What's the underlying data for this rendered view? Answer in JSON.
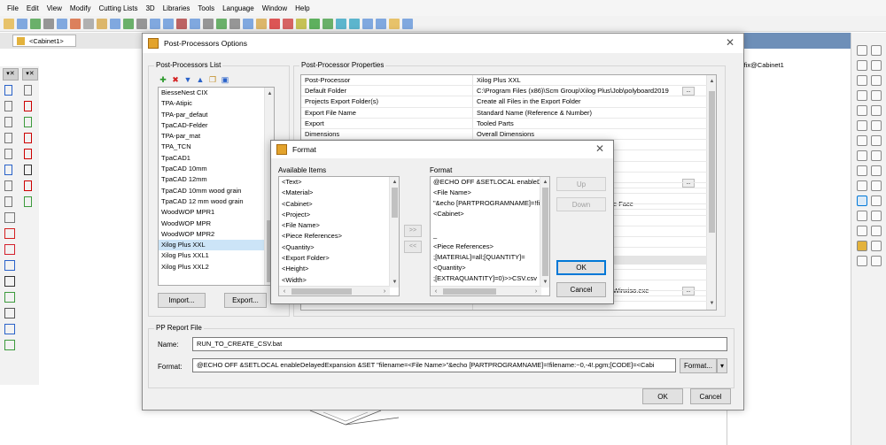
{
  "menu": [
    "File",
    "Edit",
    "View",
    "Modify",
    "Cutting Lists",
    "3D",
    "Libraries",
    "Tools",
    "Language",
    "Window",
    "Help"
  ],
  "doc_tab": "<Cabinet1>",
  "bg_panel_text": "rafix@Cabinet1",
  "left_tools_head": [
    "▾✕",
    "▾✕"
  ],
  "colors": {
    "accent": "#0078d7",
    "selection": "#cce4f7",
    "title_panel": "#6e8fb8"
  },
  "dialog": {
    "title": "Post-Processors Options",
    "pp_list": {
      "label": "Post-Processors List",
      "toolbar_icons": [
        "add-icon",
        "delete-icon",
        "move-down-icon",
        "move-up-icon",
        "copy-icon",
        "save-icon"
      ],
      "items": [
        "BiesseNest CIX",
        "TPA-Atipic",
        "TPA-par_defaut",
        "TpaCAD-Felder",
        "TPA-par_mat",
        "TPA_TCN",
        "TpaCAD1",
        "TpaCAD 10mm",
        "TpaCAD 12mm",
        "TpaCAD 10mm wood grain",
        "TpaCAD 12 mm wood grain",
        "WoodWOP MPR1",
        "WoodWOP MPR",
        "WoodWOP MPR2",
        "Xilog Plus XXL",
        "Xilog Plus XXL1",
        "Xilog Plus XXL2"
      ],
      "selected": "Xilog Plus XXL"
    },
    "import_label": "Import...",
    "export_label": "Export...",
    "props": {
      "label": "Post-Processor Properties",
      "rows": [
        {
          "k": "Post-Processor",
          "v": "Xilog Plus XXL"
        },
        {
          "k": "Default Folder",
          "v": "C:\\Program Files (x86)\\Scm Group\\Xilog Plus\\Job\\polyboard2019",
          "dots": "..."
        },
        {
          "k": "Projects Export Folder(s)",
          "v": "Create all Files in the Export Folder"
        },
        {
          "k": "Export File Name",
          "v": "Standard Name (Reference & Number)"
        },
        {
          "k": "Export",
          "v": "Tooled Parts"
        },
        {
          "k": "Dimensions",
          "v": "Overall Dimensions"
        }
      ],
      "partial": [
        {
          "v": "",
          "dots": "..."
        },
        {
          "v": "e Face"
        },
        {
          "v": "Winxiso.exe",
          "dots": "..."
        }
      ]
    },
    "report": {
      "label": "PP Report File",
      "name_label": "Name:",
      "name_value": "RUN_TO_CREATE_CSV.bat",
      "format_label": "Format:",
      "format_value": "@ECHO OFF &SETLOCAL enableDelayedExpansion &SET \"filename=<File Name>\"&echo [PARTPROGRAMNAME]=!filename:~0,-4!.pgm;[CODE]=<Cabi",
      "format_button": "Format...",
      "dropdown_arrow": "▾"
    },
    "ok": "OK",
    "cancel": "Cancel"
  },
  "format_dialog": {
    "title": "Format",
    "available_label": "Available Items",
    "available": [
      "<Text>",
      "<Material>",
      "<Cabinet>",
      "<Project>",
      "<File Name>",
      "<Piece References>",
      "<Quantity>",
      "<Export Folder>",
      "<Height>",
      "<Width>"
    ],
    "format_label": "Format",
    "format_lines": [
      "@ECHO OFF &SETLOCAL enableDela",
      "<File Name>",
      "\"&echo [PARTPROGRAMNAME]=!file",
      "<Cabinet>",
      "",
      "_",
      "<Piece References>",
      ";[MATERIAL]=all;[QUANTITY]=",
      "<Quantity>",
      ";[EXTRAQUANTITY]=0)>>CSV.csv"
    ],
    "add": ">>",
    "remove": "<<",
    "up": "Up",
    "down": "Down",
    "ok": "OK",
    "cancel": "Cancel"
  }
}
